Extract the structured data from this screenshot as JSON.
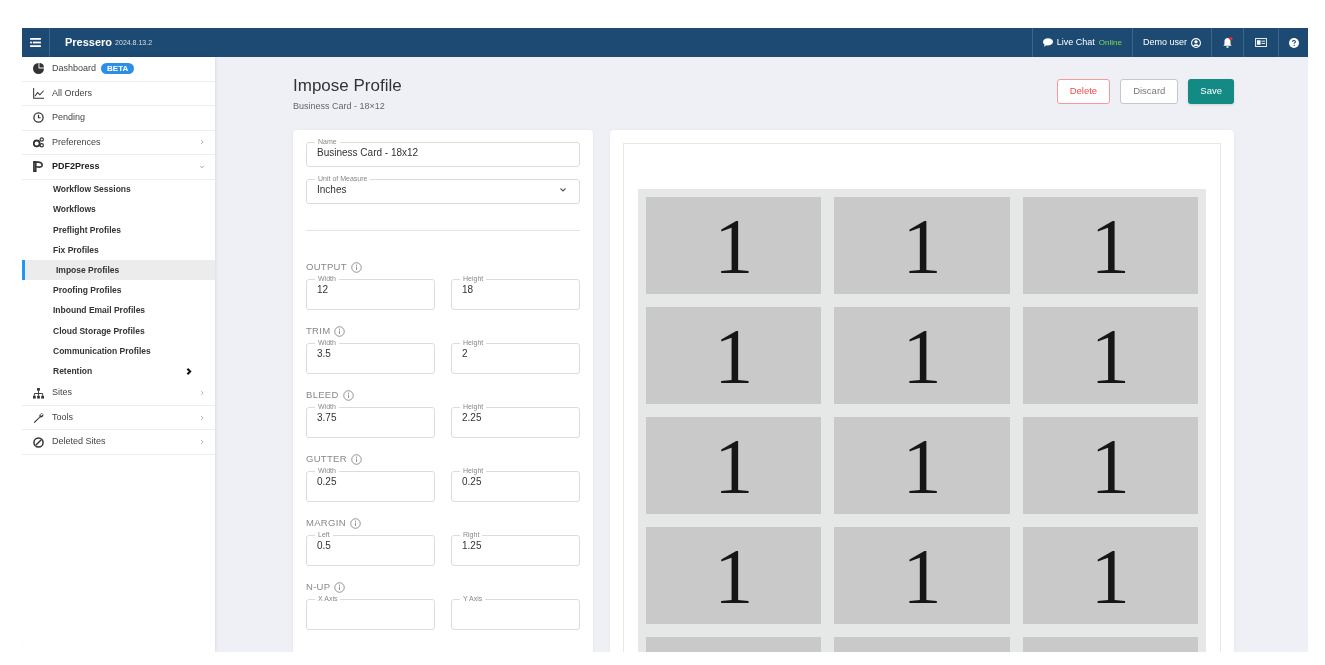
{
  "topbar": {
    "app_name": "Pressero",
    "version": "2024.8.13.2",
    "live_chat": "Live Chat",
    "chat_status": "Online",
    "user": "Demo user",
    "notifications_unread": true
  },
  "sidebar": {
    "items": [
      {
        "label": "Dashboard",
        "badge": "BETA",
        "kind": "link"
      },
      {
        "label": "All Orders",
        "kind": "link"
      },
      {
        "label": "Pending",
        "kind": "link"
      },
      {
        "label": "Preferences",
        "kind": "group",
        "expanded": false
      },
      {
        "label": "PDF2Press",
        "kind": "group",
        "expanded": true,
        "children": [
          {
            "label": "Workflow Sessions",
            "kind": "link",
            "selected": false
          },
          {
            "label": "Workflows",
            "kind": "link",
            "selected": false
          },
          {
            "label": "Preflight Profiles",
            "kind": "link",
            "selected": false
          },
          {
            "label": "Fix Profiles",
            "kind": "link",
            "selected": false
          },
          {
            "label": "Impose Profiles",
            "kind": "link",
            "selected": true
          },
          {
            "label": "Proofing Profiles",
            "kind": "link",
            "selected": false
          },
          {
            "label": "Inbound Email Profiles",
            "kind": "link",
            "selected": false
          },
          {
            "label": "Cloud Storage Profiles",
            "kind": "link",
            "selected": false
          },
          {
            "label": "Communication Profiles",
            "kind": "link",
            "selected": false
          },
          {
            "label": "Retention",
            "kind": "group",
            "selected": false,
            "expanded": false
          }
        ]
      },
      {
        "label": "Sites",
        "kind": "group",
        "expanded": false
      },
      {
        "label": "Tools",
        "kind": "group",
        "expanded": false
      },
      {
        "label": "Deleted Sites",
        "kind": "group",
        "expanded": false
      }
    ]
  },
  "page": {
    "title": "Impose Profile",
    "subtitle": "Business Card - 18×12",
    "buttons": [
      {
        "label": "Delete",
        "kind": "danger"
      },
      {
        "label": "Discard",
        "kind": "secondary"
      },
      {
        "label": "Save",
        "kind": "primary"
      }
    ]
  },
  "form": {
    "name": {
      "label": "Name",
      "value": "Business Card - 18x12"
    },
    "unit": {
      "label": "Unit of Measure",
      "value": "Inches"
    },
    "sections": [
      {
        "title": "OUTPUT",
        "fields": [
          {
            "label": "Width",
            "value": "12"
          },
          {
            "label": "Height",
            "value": "18"
          }
        ]
      },
      {
        "title": "TRIM",
        "fields": [
          {
            "label": "Width",
            "value": "3.5"
          },
          {
            "label": "Height",
            "value": "2"
          }
        ]
      },
      {
        "title": "BLEED",
        "fields": [
          {
            "label": "Width",
            "value": "3.75"
          },
          {
            "label": "Height",
            "value": "2.25"
          }
        ]
      },
      {
        "title": "GUTTER",
        "fields": [
          {
            "label": "Width",
            "value": "0.25"
          },
          {
            "label": "Height",
            "value": "0.25"
          }
        ]
      },
      {
        "title": "MARGIN",
        "fields": [
          {
            "label": "Left",
            "value": "0.5"
          },
          {
            "label": "Right",
            "value": "1.25"
          }
        ]
      },
      {
        "title": "N-UP",
        "fields": [
          {
            "label": "X Axis"
          },
          {
            "label": "Y Axis"
          }
        ]
      }
    ]
  },
  "preview": {
    "rows": [
      [
        "1",
        "1",
        "1"
      ],
      [
        "1",
        "1",
        "1"
      ],
      [
        "1",
        "1",
        "1"
      ],
      [
        "1",
        "1",
        "1"
      ]
    ]
  }
}
